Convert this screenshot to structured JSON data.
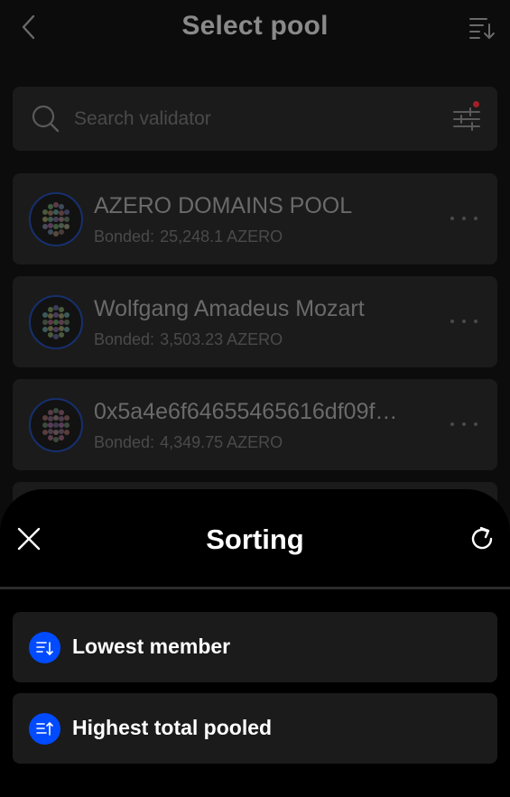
{
  "header": {
    "title": "Select pool",
    "back_icon": "chevron-left-icon",
    "sort_icon": "sort-descending-icon"
  },
  "search": {
    "placeholder": "Search validator",
    "icon": "search-icon",
    "filter_icon": "filter-sliders-icon",
    "filter_dot_color": "#a31f27"
  },
  "pools": [
    {
      "name": "AZERO DOMAINS POOL",
      "bonded_label": "Bonded:",
      "bonded_value": "25,248.1 AZERO"
    },
    {
      "name": "Wolfgang Amadeus Mozart",
      "bonded_label": "Bonded:",
      "bonded_value": "3,503.23 AZERO"
    },
    {
      "name": "0x5a4e6f64655465616df09f…",
      "bonded_label": "Bonded:",
      "bonded_value": "4,349.75 AZERO"
    }
  ],
  "sheet": {
    "title": "Sorting",
    "close_icon": "close-icon",
    "reset_icon": "refresh-icon",
    "options": [
      {
        "label": "Lowest member",
        "icon": "sort-descending-icon"
      },
      {
        "label": "Highest total pooled",
        "icon": "sort-ascending-icon"
      }
    ]
  },
  "colors": {
    "background": "#0c0c0c",
    "card": "#1b1b1b",
    "sheet": "#000000",
    "accent": "#004bff",
    "avatar_ring": "#16306e"
  }
}
